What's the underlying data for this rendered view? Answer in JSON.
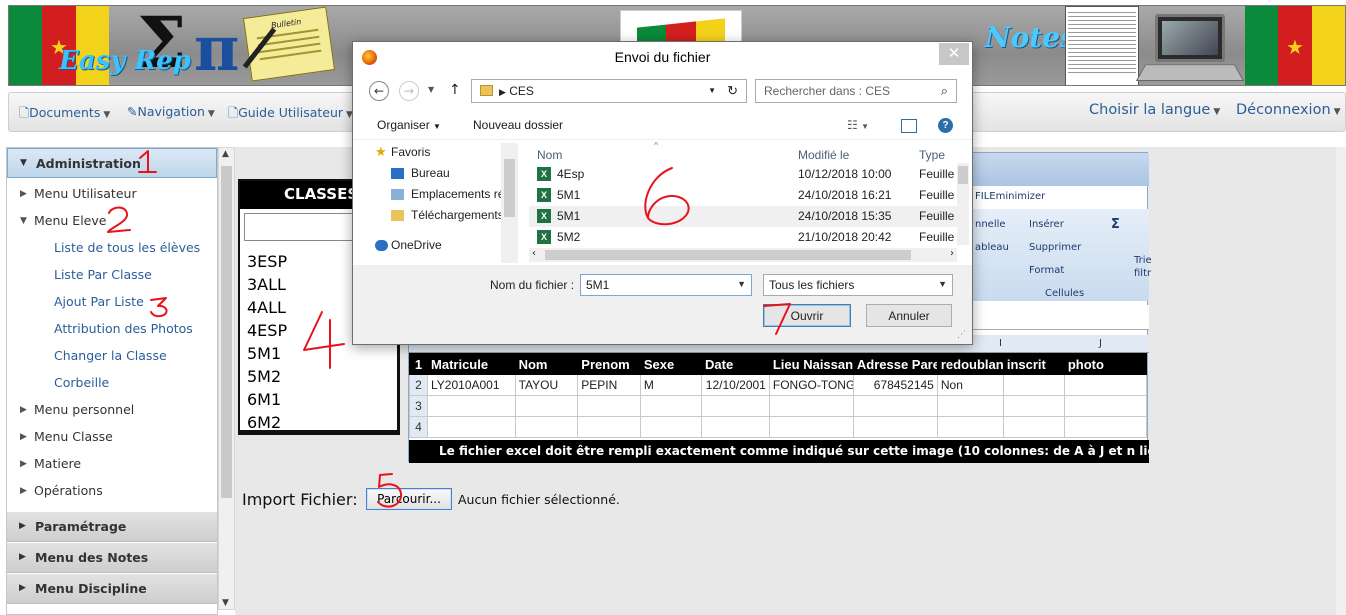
{
  "banner": {
    "logo_left": "Easy Rep",
    "logo_right": "Notes",
    "bulletin": "Bulletin"
  },
  "navbar": {
    "left": [
      {
        "label": "Documents"
      },
      {
        "label": "Navigation"
      },
      {
        "label": "Guide Utilisateur"
      }
    ],
    "right": [
      {
        "label": "Choisir la langue"
      },
      {
        "label": "Déconnexion"
      }
    ]
  },
  "sidebar": {
    "sections": [
      {
        "label": "Administration"
      },
      {
        "label": "Paramétrage"
      },
      {
        "label": "Menu des Notes"
      },
      {
        "label": "Menu Discipline"
      }
    ],
    "admin_items": [
      {
        "label": "Menu Utilisateur"
      },
      {
        "label": "Menu Eleve"
      },
      {
        "label": "Menu personnel"
      },
      {
        "label": "Menu Classe"
      },
      {
        "label": "Matiere"
      },
      {
        "label": "Opérations"
      }
    ],
    "eleve_subitems": [
      {
        "label": "Liste de tous les élèves"
      },
      {
        "label": "Liste Par Classe"
      },
      {
        "label": "Ajout Par Liste"
      },
      {
        "label": "Attribution des Photos"
      },
      {
        "label": "Changer la Classe"
      },
      {
        "label": "Corbeille"
      }
    ]
  },
  "classes_panel": {
    "title": "CLASSES",
    "items": [
      "3ESP",
      "3ALL",
      "4ALL",
      "4ESP",
      "5M1",
      "5M2",
      "6M1",
      "6M2"
    ]
  },
  "excel_example": {
    "ribbon_labels": [
      "FILEminimizer",
      "nnelle",
      "Insérer",
      "Supprimer",
      "Format",
      "ableau",
      "Cellules",
      "Σ",
      "Trie",
      "filtr"
    ],
    "col_letters": [
      "I",
      "J"
    ],
    "headers": [
      "Matricule",
      "Nom",
      "Prenom",
      "Sexe",
      "Date",
      "Lieu Naissance",
      "Adresse Parent",
      "redoublant",
      "inscrit",
      "photo"
    ],
    "rows": [
      {
        "num": "1"
      },
      {
        "num": "2",
        "cells": [
          "LY2010A001",
          "TAYOU",
          "PEPIN",
          "M",
          "12/10/2001",
          "FONGO-TONGO",
          "678452145",
          "Non",
          "",
          ""
        ]
      },
      {
        "num": "3",
        "cells": [
          "",
          "",
          "",
          "",
          "",
          "",
          "",
          "",
          "",
          ""
        ]
      },
      {
        "num": "4",
        "cells": [
          "",
          "",
          "",
          "",
          "",
          "",
          "",
          "",
          "",
          ""
        ]
      }
    ],
    "caption": "Le fichier excel doit être rempli exactement comme indiqué sur cette image (10 colonnes: de A à  J  et n lignes: de 2 à n élèves)"
  },
  "import": {
    "label": "Import Fichier:",
    "button": "Parcourir...",
    "status": "Aucun fichier sélectionné."
  },
  "file_dialog": {
    "title": "Envoi du fichier",
    "close": "✕",
    "path": "CES",
    "search_placeholder": "Rechercher dans : CES",
    "organize": "Organiser",
    "new_folder": "Nouveau dossier",
    "nav_pane": [
      {
        "label": "Favoris"
      },
      {
        "label": "Bureau"
      },
      {
        "label": "Emplacements ré"
      },
      {
        "label": "Téléchargements"
      },
      {
        "label": "OneDrive"
      }
    ],
    "columns": {
      "name": "Nom",
      "modified": "Modifié le",
      "type": "Type"
    },
    "files": [
      {
        "name": "4Esp",
        "modified": "10/12/2018 10:00",
        "type": "Feuille"
      },
      {
        "name": "5M1",
        "modified": "24/10/2018 16:21",
        "type": "Feuille"
      },
      {
        "name": "5M1",
        "modified": "24/10/2018 15:35",
        "type": "Feuille"
      },
      {
        "name": "5M2",
        "modified": "21/10/2018 20:42",
        "type": "Feuille"
      }
    ],
    "filename_label": "Nom du fichier :",
    "filename_value": "5M1",
    "filter": "Tous les fichiers",
    "open_button": "Ouvrir",
    "cancel_button": "Annuler"
  },
  "annotations": [
    "1",
    "2",
    "3",
    "4",
    "5",
    "6",
    "7"
  ],
  "colors": {
    "accent_blue": "#2a5e99",
    "annotation_red": "#e8121b",
    "banner_grey": "#9a9a9a",
    "cameroon_green": "#0a8a3a",
    "cameroon_red": "#d21e1e",
    "cameroon_yellow": "#f3d21b"
  }
}
